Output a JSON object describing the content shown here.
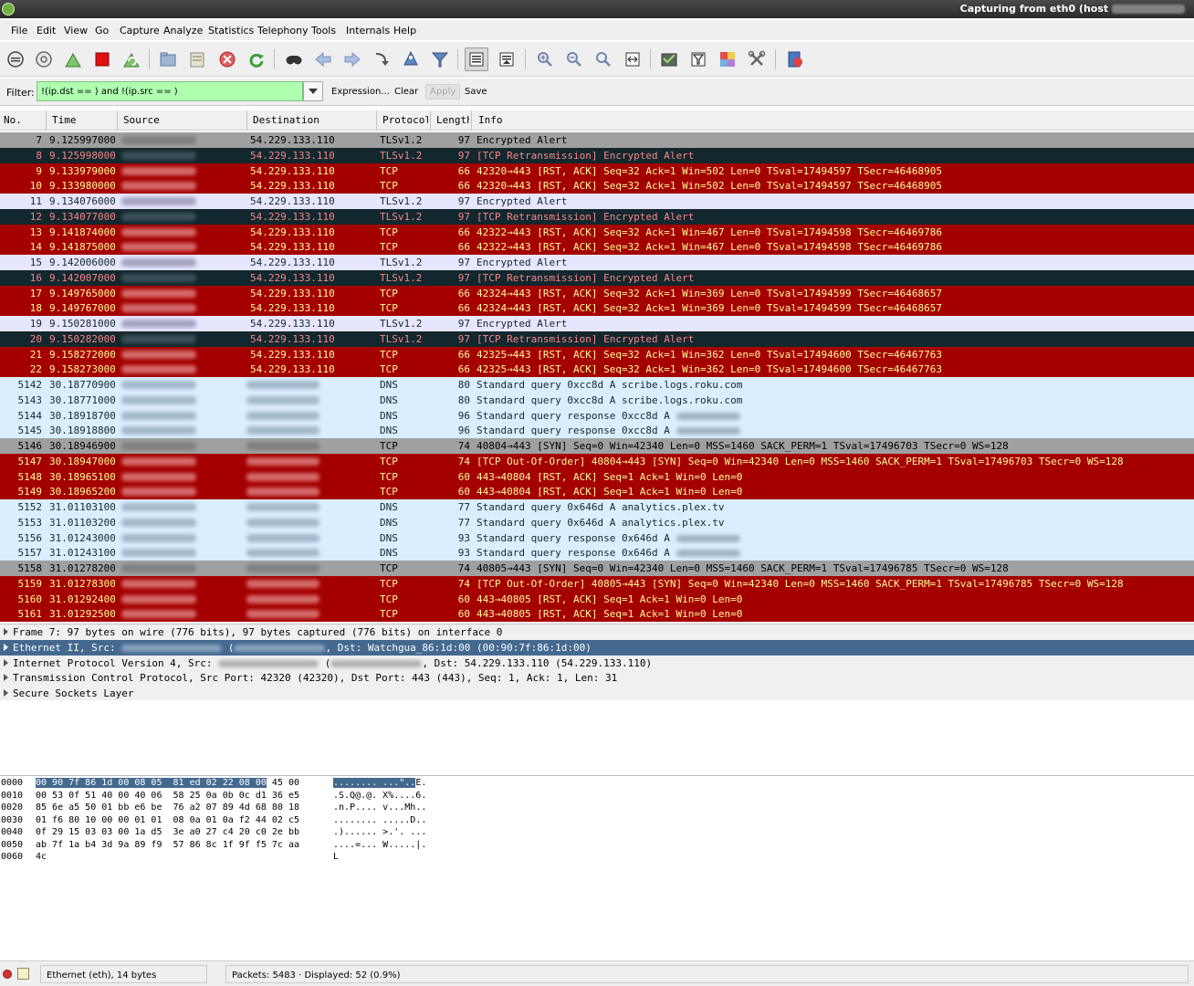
{
  "window": {
    "title": "Capturing from eth0 (host"
  },
  "menu": [
    "File",
    "Edit",
    "View",
    "Go",
    "Capture",
    "Analyze",
    "Statistics",
    "Telephony",
    "Tools",
    "Internals",
    "Help"
  ],
  "toolbar": {
    "icons": [
      "interfaces-icon",
      "options-icon",
      "start-capture-icon",
      "stop-capture-icon",
      "restart-capture-icon",
      "open-file-icon",
      "save-file-icon",
      "close-file-icon",
      "reload-icon",
      "find-packet-icon",
      "go-back-icon",
      "go-forward-icon",
      "go-to-packet-icon",
      "go-first-icon",
      "filter-icon",
      "colorize-icon",
      "autoscroll-icon",
      "zoom-in-icon",
      "zoom-out-icon",
      "normal-size-icon",
      "resize-columns-icon",
      "capture-filters-icon",
      "display-filters-icon",
      "coloring-rules-icon",
      "preferences-icon",
      "help-icon"
    ]
  },
  "filter": {
    "label": "Filter:",
    "value": "!(ip.dst ==            ) and !(ip.src ==            )",
    "expression_label": "Expression...",
    "clear_label": "Clear",
    "apply_label": "Apply",
    "save_label": "Save"
  },
  "packet_list": {
    "columns": [
      "No.",
      "Time",
      "Source",
      "Destination",
      "Protocol",
      "Length",
      "Info"
    ],
    "rows": [
      {
        "no": "7",
        "time": "9.125997000",
        "dst": "54.229.133.110",
        "proto": "TLSv1.2",
        "len": "97",
        "info": "Encrypted Alert",
        "color": "gray"
      },
      {
        "no": "8",
        "time": "9.125998000",
        "dst": "54.229.133.110",
        "proto": "TLSv1.2",
        "len": "97",
        "info": "[TCP Retransmission] Encrypted Alert",
        "color": "dark"
      },
      {
        "no": "9",
        "time": "9.133979000",
        "dst": "54.229.133.110",
        "proto": "TCP",
        "len": "66",
        "info": "42320→443 [RST, ACK] Seq=32 Ack=1 Win=502 Len=0 TSval=17494597 TSecr=46468905",
        "color": "red"
      },
      {
        "no": "10",
        "time": "9.133980000",
        "dst": "54.229.133.110",
        "proto": "TCP",
        "len": "66",
        "info": "42320→443 [RST, ACK] Seq=32 Ack=1 Win=502 Len=0 TSval=17494597 TSecr=46468905",
        "color": "red"
      },
      {
        "no": "11",
        "time": "9.134076000",
        "dst": "54.229.133.110",
        "proto": "TLSv1.2",
        "len": "97",
        "info": "Encrypted Alert",
        "color": "lav"
      },
      {
        "no": "12",
        "time": "9.134077000",
        "dst": "54.229.133.110",
        "proto": "TLSv1.2",
        "len": "97",
        "info": "[TCP Retransmission] Encrypted Alert",
        "color": "dark"
      },
      {
        "no": "13",
        "time": "9.141874000",
        "dst": "54.229.133.110",
        "proto": "TCP",
        "len": "66",
        "info": "42322→443 [RST, ACK] Seq=32 Ack=1 Win=467 Len=0 TSval=17494598 TSecr=46469786",
        "color": "red"
      },
      {
        "no": "14",
        "time": "9.141875000",
        "dst": "54.229.133.110",
        "proto": "TCP",
        "len": "66",
        "info": "42322→443 [RST, ACK] Seq=32 Ack=1 Win=467 Len=0 TSval=17494598 TSecr=46469786",
        "color": "red"
      },
      {
        "no": "15",
        "time": "9.142006000",
        "dst": "54.229.133.110",
        "proto": "TLSv1.2",
        "len": "97",
        "info": "Encrypted Alert",
        "color": "lav"
      },
      {
        "no": "16",
        "time": "9.142007000",
        "dst": "54.229.133.110",
        "proto": "TLSv1.2",
        "len": "97",
        "info": "[TCP Retransmission] Encrypted Alert",
        "color": "dark"
      },
      {
        "no": "17",
        "time": "9.149765000",
        "dst": "54.229.133.110",
        "proto": "TCP",
        "len": "66",
        "info": "42324→443 [RST, ACK] Seq=32 Ack=1 Win=369 Len=0 TSval=17494599 TSecr=46468657",
        "color": "red"
      },
      {
        "no": "18",
        "time": "9.149767000",
        "dst": "54.229.133.110",
        "proto": "TCP",
        "len": "66",
        "info": "42324→443 [RST, ACK] Seq=32 Ack=1 Win=369 Len=0 TSval=17494599 TSecr=46468657",
        "color": "red"
      },
      {
        "no": "19",
        "time": "9.150281000",
        "dst": "54.229.133.110",
        "proto": "TLSv1.2",
        "len": "97",
        "info": "Encrypted Alert",
        "color": "lav"
      },
      {
        "no": "20",
        "time": "9.150282000",
        "dst": "54.229.133.110",
        "proto": "TLSv1.2",
        "len": "97",
        "info": "[TCP Retransmission] Encrypted Alert",
        "color": "dark"
      },
      {
        "no": "21",
        "time": "9.158272000",
        "dst": "54.229.133.110",
        "proto": "TCP",
        "len": "66",
        "info": "42325→443 [RST, ACK] Seq=32 Ack=1 Win=362 Len=0 TSval=17494600 TSecr=46467763",
        "color": "red"
      },
      {
        "no": "22",
        "time": "9.158273000",
        "dst": "54.229.133.110",
        "proto": "TCP",
        "len": "66",
        "info": "42325→443 [RST, ACK] Seq=32 Ack=1 Win=362 Len=0 TSval=17494600 TSecr=46467763",
        "color": "red"
      },
      {
        "no": "5142",
        "time": "30.18770900(",
        "dst": "",
        "proto": "DNS",
        "len": "80",
        "info": "Standard query 0xcc8d  A scribe.logs.roku.com",
        "color": "blue"
      },
      {
        "no": "5143",
        "time": "30.18771000(",
        "dst": "",
        "proto": "DNS",
        "len": "80",
        "info": "Standard query 0xcc8d  A scribe.logs.roku.com",
        "color": "blue"
      },
      {
        "no": "5144",
        "time": "30.18918700(",
        "dst": "",
        "proto": "DNS",
        "len": "96",
        "info": "Standard query response 0xcc8d  A ",
        "color": "blue",
        "blur_tail": true
      },
      {
        "no": "5145",
        "time": "30.18918800(",
        "dst": "",
        "proto": "DNS",
        "len": "96",
        "info": "Standard query response 0xcc8d  A ",
        "color": "blue",
        "blur_tail": true
      },
      {
        "no": "5146",
        "time": "30.18946900(",
        "dst": "",
        "proto": "TCP",
        "len": "74",
        "info": "40804→443 [SYN] Seq=0 Win=42340 Len=0 MSS=1460 SACK_PERM=1 TSval=17496703 TSecr=0 WS=128",
        "color": "gray"
      },
      {
        "no": "5147",
        "time": "30.18947000(",
        "dst": "",
        "proto": "TCP",
        "len": "74",
        "info": "[TCP Out-Of-Order] 40804→443 [SYN] Seq=0 Win=42340 Len=0 MSS=1460 SACK_PERM=1 TSval=17496703 TSecr=0 WS=128",
        "color": "red"
      },
      {
        "no": "5148",
        "time": "30.18965100(",
        "dst": "",
        "proto": "TCP",
        "len": "60",
        "info": "443→40804 [RST, ACK] Seq=1 Ack=1 Win=0 Len=0",
        "color": "red"
      },
      {
        "no": "5149",
        "time": "30.18965200(",
        "dst": "",
        "proto": "TCP",
        "len": "60",
        "info": "443→40804 [RST, ACK] Seq=1 Ack=1 Win=0 Len=0",
        "color": "red"
      },
      {
        "no": "5152",
        "time": "31.01103100(",
        "dst": "",
        "proto": "DNS",
        "len": "77",
        "info": "Standard query 0x646d  A analytics.plex.tv",
        "color": "blue"
      },
      {
        "no": "5153",
        "time": "31.01103200(",
        "dst": "",
        "proto": "DNS",
        "len": "77",
        "info": "Standard query 0x646d  A analytics.plex.tv",
        "color": "blue"
      },
      {
        "no": "5156",
        "time": "31.01243000(",
        "dst": "",
        "proto": "DNS",
        "len": "93",
        "info": "Standard query response 0x646d  A ",
        "color": "blue",
        "blur_tail": true
      },
      {
        "no": "5157",
        "time": "31.01243100(",
        "dst": "",
        "proto": "DNS",
        "len": "93",
        "info": "Standard query response 0x646d  A ",
        "color": "blue",
        "blur_tail": true
      },
      {
        "no": "5158",
        "time": "31.01278200(",
        "dst": "",
        "proto": "TCP",
        "len": "74",
        "info": "40805→443 [SYN] Seq=0 Win=42340 Len=0 MSS=1460 SACK_PERM=1 TSval=17496785 TSecr=0 WS=128",
        "color": "gray"
      },
      {
        "no": "5159",
        "time": "31.01278300(",
        "dst": "",
        "proto": "TCP",
        "len": "74",
        "info": "[TCP Out-Of-Order] 40805→443 [SYN] Seq=0 Win=42340 Len=0 MSS=1460 SACK_PERM=1 TSval=17496785 TSecr=0 WS=128",
        "color": "red"
      },
      {
        "no": "5160",
        "time": "31.01292400(",
        "dst": "",
        "proto": "TCP",
        "len": "60",
        "info": "443→40805 [RST, ACK] Seq=1 Ack=1 Win=0 Len=0",
        "color": "red"
      },
      {
        "no": "5161",
        "time": "31.01292500(",
        "dst": "",
        "proto": "TCP",
        "len": "60",
        "info": "443→40805 [RST, ACK] Seq=1 Ack=1 Win=0 Len=0",
        "color": "red"
      }
    ]
  },
  "details": [
    {
      "text": "Frame 7: 97 bytes on wire (776 bits), 97 bytes captured (776 bits) on interface 0",
      "selected": false
    },
    {
      "text": "Ethernet II, Src: ",
      "tail": "Dst: Watchgua_86:1d:00 (00:90:7f:86:1d:00)",
      "selected": true
    },
    {
      "text": "Internet Protocol Version 4, Src: ",
      "tail": "Dst: 54.229.133.110 (54.229.133.110)",
      "selected": false
    },
    {
      "text": "Transmission Control Protocol, Src Port: 42320 (42320), Dst Port: 443 (443), Seq: 1, Ack: 1, Len: 31",
      "selected": false
    },
    {
      "text": "Secure Sockets Layer",
      "selected": false
    }
  ],
  "hex": [
    {
      "off": "0000",
      "hl": "00 90 7f 86 1d 00 08 05  81 ed 02 22 08 00",
      "rest": " 45 00",
      "ahl": "........ ...\"..",
      "arest": "E."
    },
    {
      "off": "0010",
      "hl": "",
      "rest": "00 53 0f 51 40 00 40 06  58 25 0a 0b 0c d1 36 e5",
      "ahl": "",
      "arest": ".S.Q@.@. X%....6."
    },
    {
      "off": "0020",
      "hl": "",
      "rest": "85 6e a5 50 01 bb e6 be  76 a2 07 89 4d 68 80 18",
      "ahl": "",
      "arest": ".n.P.... v...Mh.."
    },
    {
      "off": "0030",
      "hl": "",
      "rest": "01 f6 80 10 00 00 01 01  08 0a 01 0a f2 44 02 c5",
      "ahl": "",
      "arest": "........ .....D.."
    },
    {
      "off": "0040",
      "hl": "",
      "rest": "0f 29 15 03 03 00 1a d5  3e a0 27 c4 20 c0 2e bb",
      "ahl": "",
      "arest": ".)...... >.'. ..."
    },
    {
      "off": "0050",
      "hl": "",
      "rest": "ab 7f 1a b4 3d 9a 89 f9  57 86 8c 1f 9f f5 7c aa",
      "ahl": "",
      "arest": "....=... W.....|."
    },
    {
      "off": "0060",
      "hl": "",
      "rest": "4c",
      "ahl": "",
      "arest": "L"
    }
  ],
  "status": {
    "field": "Ethernet (eth), 14 bytes",
    "packets": "Packets: 5483 · Displayed: 52 (0.9%)"
  }
}
